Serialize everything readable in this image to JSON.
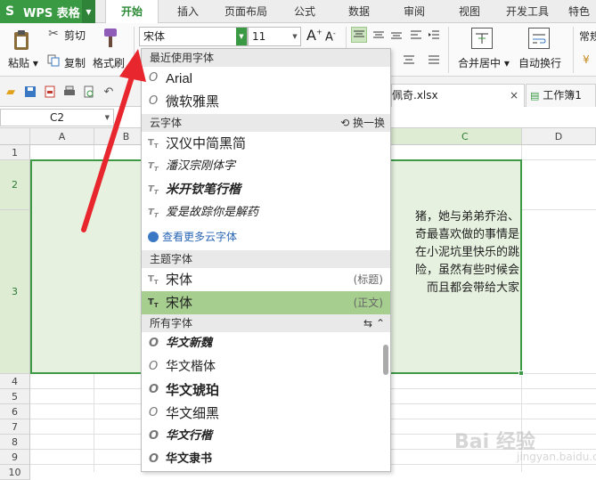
{
  "app": {
    "name": "WPS 表格",
    "logo_icon": "S"
  },
  "menu_tabs": [
    "开始",
    "插入",
    "页面布局",
    "公式",
    "数据",
    "审阅",
    "视图",
    "开发工具",
    "特色"
  ],
  "ribbon": {
    "paste": "粘贴",
    "cut": "剪切",
    "copy": "复制",
    "format_painter": "格式刷",
    "font_name": "宋体",
    "font_size": "11",
    "grow_font": "A",
    "shrink_font": "A",
    "merge_center": "合并居中",
    "auto_wrap": "自动换行",
    "number_format": "常规"
  },
  "document_tabs": {
    "file": "佩奇.xlsx",
    "workbook": "工作簿1"
  },
  "formula_bar": {
    "cell_ref": "C2"
  },
  "columns": [
    "A",
    "B",
    "C",
    "D"
  ],
  "rows": [
    "1",
    "2",
    "3",
    "4",
    "5",
    "6",
    "7",
    "8",
    "9",
    "10"
  ],
  "cell_text": [
    "猪，她与弟弟乔治、",
    "奇最喜欢做的事情是",
    "在小泥坑里快乐的跳",
    "险，虽然有些时候会",
    "而且都会带给大家"
  ],
  "font_dropdown": {
    "recent_header": "最近使用字体",
    "recent": [
      "Arial",
      "微软雅黑"
    ],
    "cloud_header": "云字体",
    "cloud_action": "换一换",
    "cloud": [
      "汉仪中简黑简",
      "潘汉宗刚体字",
      "米开钦笔行楷",
      "爱是故踪你是解药"
    ],
    "more_cloud": "查看更多云字体",
    "theme_header": "主题字体",
    "theme": [
      {
        "name": "宋体",
        "tag": "(标题)"
      },
      {
        "name": "宋体",
        "tag": "(正文)"
      }
    ],
    "all_header": "所有字体",
    "all": [
      "华文新魏",
      "华文楷体",
      "华文琥珀",
      "华文细黑",
      "华文行楷",
      "华文隶书"
    ]
  },
  "watermark": {
    "brand": "Bai 经验",
    "url": "jingyan.baidu.com"
  },
  "colors": {
    "brand_green": "#3a9a44",
    "highlight": "#a6cf8f",
    "arrow": "#e8262d"
  }
}
